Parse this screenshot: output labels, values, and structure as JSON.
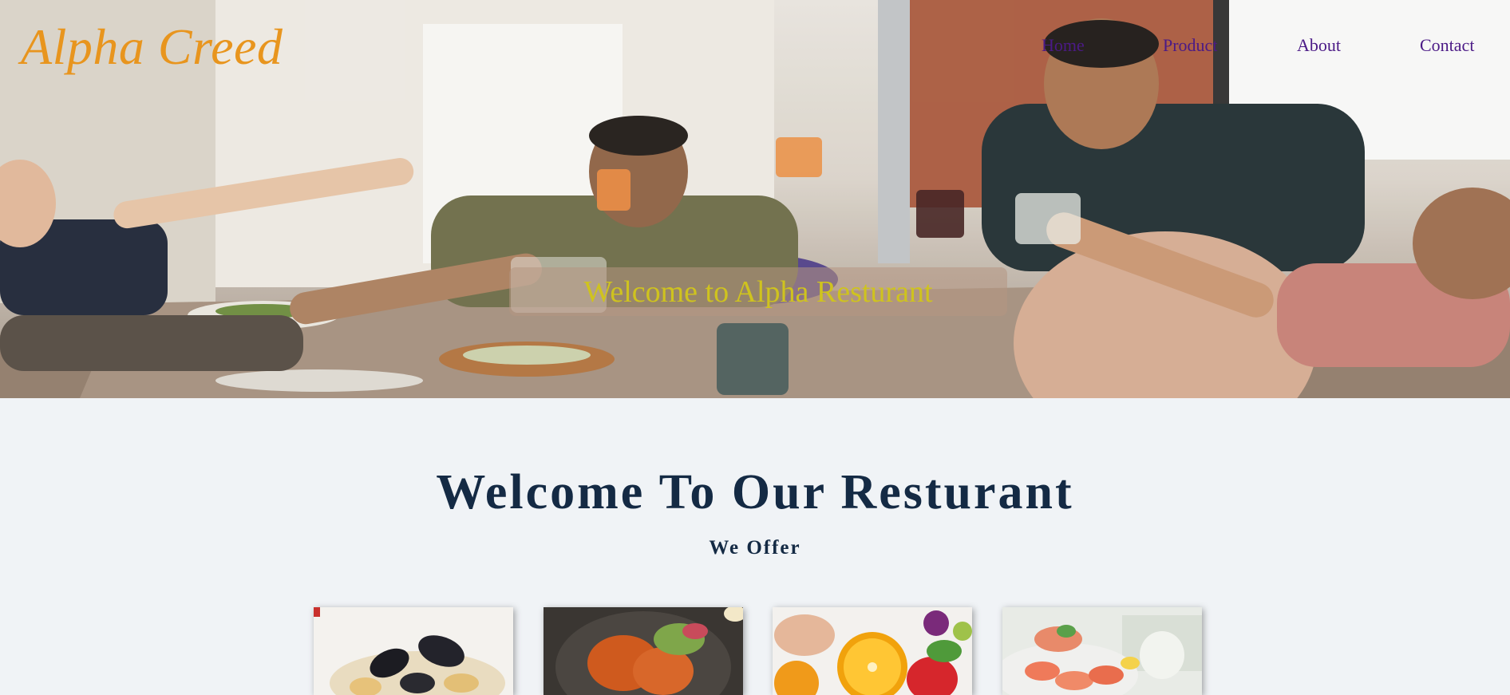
{
  "brand": {
    "name": "Alpha Creed"
  },
  "nav": {
    "items": [
      {
        "label": "Home"
      },
      {
        "label": "Product"
      },
      {
        "label": "About"
      },
      {
        "label": "Contact"
      }
    ]
  },
  "hero": {
    "welcome_text": "Welcome to Alpha Resturant"
  },
  "main": {
    "title": "Welcome To Our Resturant",
    "subtitle": "We Offer",
    "cards": [
      {
        "image": "mussels-pasta"
      },
      {
        "image": "fried-chicken-salad"
      },
      {
        "image": "oranges-strawberries"
      },
      {
        "image": "shrimp-platter"
      }
    ]
  },
  "colors": {
    "brand": "#e8951e",
    "nav_link": "#4b1a86",
    "welcome_text": "#cfc31e",
    "heading": "#142a44",
    "page_background": "#f0f3f6"
  }
}
